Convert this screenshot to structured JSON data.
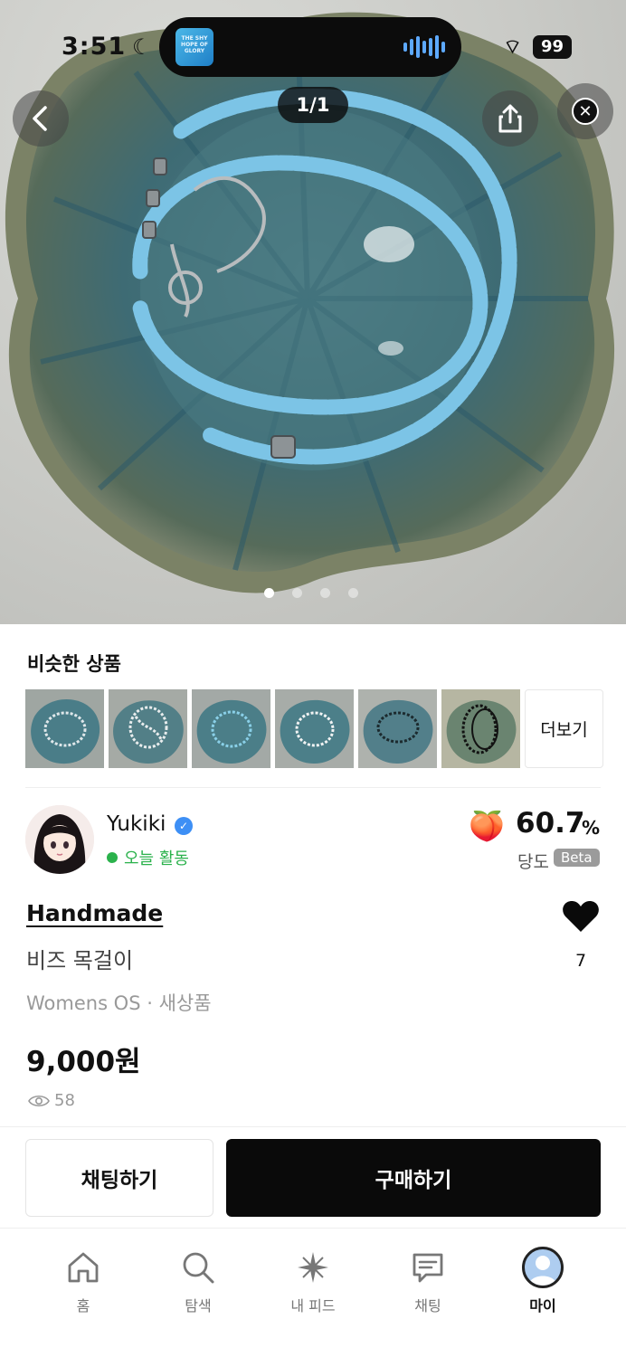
{
  "status_bar": {
    "time": "3:51",
    "battery": "99",
    "album_art_text": "THE SHY HOPE OF GLORY"
  },
  "hero": {
    "counter": "1/1",
    "page_count": 4,
    "active_page": 1
  },
  "similar": {
    "title": "비슷한 상품",
    "more_label": "더보기"
  },
  "seller": {
    "name": "Yukiki",
    "activity": "오늘 활동",
    "sweetness_value": "60.7",
    "sweetness_unit": "%",
    "sweetness_label": "당도",
    "beta_label": "Beta"
  },
  "product": {
    "brand": "Handmade",
    "title": "비즈 목걸이",
    "meta": "Womens OS · 새상품",
    "price": "9,000원",
    "views": "58",
    "likes": "7"
  },
  "actions": {
    "chat_label": "채팅하기",
    "buy_label": "구매하기"
  },
  "tabbar": {
    "items": [
      {
        "label": "홈",
        "icon": "home-icon"
      },
      {
        "label": "탐색",
        "icon": "search-icon"
      },
      {
        "label": "내 피드",
        "icon": "sparkle-icon"
      },
      {
        "label": "채팅",
        "icon": "chat-icon"
      },
      {
        "label": "마이",
        "icon": "profile-icon"
      }
    ]
  },
  "colors": {
    "bead_blue": "#7cc4e6",
    "accent_green": "#2bb24c",
    "verify_blue": "#3d8ff5",
    "buy_black": "#0a0a0a"
  }
}
